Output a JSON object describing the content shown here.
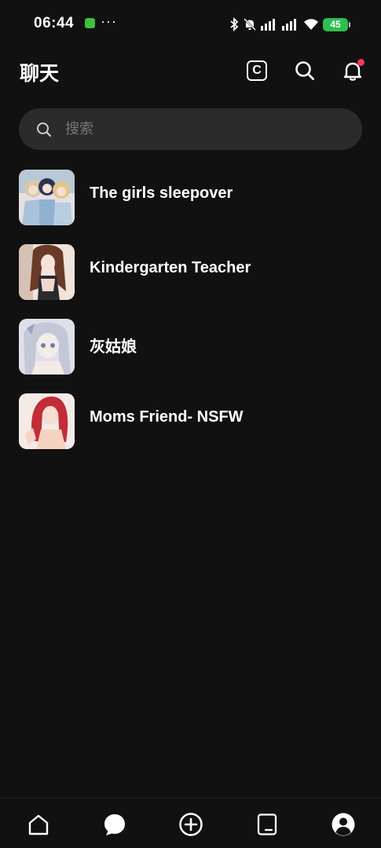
{
  "status_bar": {
    "time": "06:44",
    "more": "···",
    "battery": "45"
  },
  "header": {
    "title": "聊天",
    "coin_letter": "C"
  },
  "search": {
    "placeholder": "搜索"
  },
  "chats": [
    {
      "name": "The girls sleepover",
      "avatar_colors": [
        "#9fb6c9",
        "#e7d2c6",
        "#3a3f5a"
      ]
    },
    {
      "name": "Kindergarten Teacher",
      "avatar_colors": [
        "#d8b6a2",
        "#5a3325",
        "#f2e2d8"
      ]
    },
    {
      "name": "灰姑娘",
      "avatar_colors": [
        "#c9ccd8",
        "#eef0f5",
        "#7b86a6"
      ]
    },
    {
      "name": "Moms Friend- NSFW",
      "avatar_colors": [
        "#f3e4de",
        "#c7303a",
        "#f7d3c2"
      ]
    }
  ],
  "colors": {
    "background": "#111111",
    "search_bg": "#2b2b2b",
    "notification_dot": "#ff3355",
    "battery": "#2fbf4f"
  },
  "bottom_nav": [
    {
      "icon": "home-icon"
    },
    {
      "icon": "chat-bubble-icon",
      "active": true
    },
    {
      "icon": "plus-circle-icon"
    },
    {
      "icon": "tablet-icon"
    },
    {
      "icon": "profile-icon"
    }
  ]
}
